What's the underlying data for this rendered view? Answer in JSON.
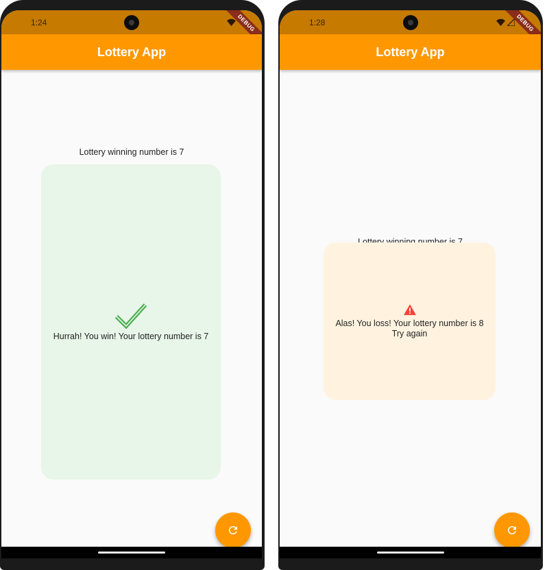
{
  "screens": [
    {
      "status_time": "1:24",
      "debug_label": "DEBUG",
      "app_title": "Lottery App",
      "winning_text": "Lottery winning number is 7",
      "card_message": "Hurrah! You win! Your lottery number is 7",
      "card_message_line2": "",
      "card_icon": "check-icon",
      "card_color": "#e8f5e9",
      "icon_color": "#4caf50",
      "fab_icon": "refresh-icon"
    },
    {
      "status_time": "1:28",
      "debug_label": "DEBUG",
      "app_title": "Lottery App",
      "winning_text": "Lottery winning number is 7",
      "card_message": "Alas! You loss! Your lottery number is 8",
      "card_message_line2": "Try again",
      "card_icon": "warning-icon",
      "card_color": "#fff3e0",
      "icon_color": "#f44336",
      "fab_icon": "refresh-icon"
    }
  ],
  "colors": {
    "app_bar": "#ff9800",
    "status_bar": "#c67a00",
    "background": "#fafafa",
    "fab": "#ff9800"
  }
}
